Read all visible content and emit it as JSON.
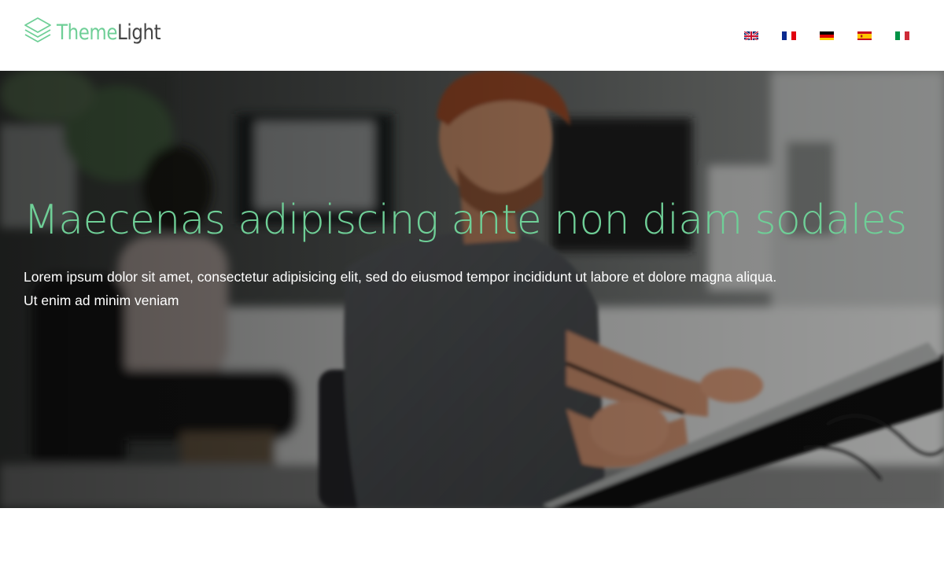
{
  "header": {
    "logo": {
      "word1": "Theme",
      "word2": "Light",
      "icon": "stacked-layers-icon",
      "colors": {
        "accent": "#6fcf97",
        "dark": "#444444"
      }
    },
    "languages": [
      {
        "code": "en",
        "icon": "flag-uk-icon"
      },
      {
        "code": "fr",
        "icon": "flag-france-icon"
      },
      {
        "code": "de",
        "icon": "flag-germany-icon"
      },
      {
        "code": "es",
        "icon": "flag-spain-icon"
      },
      {
        "code": "it",
        "icon": "flag-italy-icon"
      }
    ]
  },
  "hero": {
    "title": "Maecenas adipiscing ante non diam sodales",
    "text_line1": "Lorem ipsum dolor sit amet, consectetur adipisicing elit, sed do eiusmod tempor incididunt ut labore et dolore magna aliqua.",
    "text_line2": "Ut enim ad minim veniam",
    "background": "office-photo-designer-with-drawing-tablet",
    "colors": {
      "title": "#6fcf97",
      "text": "#ffffff"
    }
  }
}
